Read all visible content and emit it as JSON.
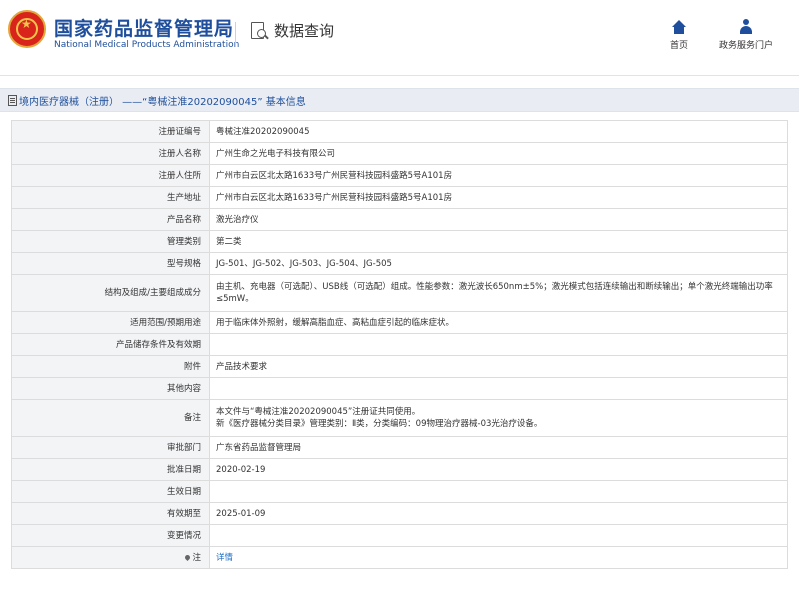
{
  "header": {
    "org_cn": "国家药品监督管理局",
    "org_en": "National Medical Products Administration",
    "section": "数据查询",
    "nav_home": "首页",
    "nav_portal": "政务服务门户",
    "home_icon": "home-icon",
    "portal_icon": "person-icon",
    "search_icon": "document-search-icon"
  },
  "titlebar": {
    "text": "境内医疗器械（注册） ——“粤械注准20202090045” 基本信息"
  },
  "rows": [
    {
      "label": "注册证编号",
      "value": "粤械注准20202090045"
    },
    {
      "label": "注册人名称",
      "value": "广州生命之光电子科技有限公司"
    },
    {
      "label": "注册人住所",
      "value": "广州市白云区北太路1633号广州民营科技园科盛路5号A101房"
    },
    {
      "label": "生产地址",
      "value": "广州市白云区北太路1633号广州民营科技园科盛路5号A101房"
    },
    {
      "label": "产品名称",
      "value": "激光治疗仪"
    },
    {
      "label": "管理类别",
      "value": "第二类"
    },
    {
      "label": "型号规格",
      "value": "JG-501、JG-502、JG-503、JG-504、JG-505"
    },
    {
      "label": "结构及组成/主要组成成分",
      "value": "由主机、充电器（可选配）、USB线（可选配）组成。性能参数：激光波长650nm±5%；激光模式包括连续输出和断续输出；单个激光终端输出功率≤5mW。"
    },
    {
      "label": "适用范围/预期用途",
      "value": "用于临床体外照射，缓解高脂血症、高粘血症引起的临床症状。"
    },
    {
      "label": "产品储存条件及有效期",
      "value": ""
    },
    {
      "label": "附件",
      "value": "产品技术要求"
    },
    {
      "label": "其他内容",
      "value": ""
    },
    {
      "label": "备注",
      "value": "本文件与“粤械注准20202090045”注册证共同使用。\n新《医疗器械分类目录》管理类别：Ⅱ类，分类编码：09物理治疗器械-03光治疗设备。"
    },
    {
      "label": "审批部门",
      "value": "广东省药品监督管理局"
    },
    {
      "label": "批准日期",
      "value": "2020-02-19"
    },
    {
      "label": "生效日期",
      "value": ""
    },
    {
      "label": "有效期至",
      "value": "2025-01-09"
    },
    {
      "label": "变更情况",
      "value": ""
    },
    {
      "label": "注",
      "value": "详情"
    }
  ]
}
